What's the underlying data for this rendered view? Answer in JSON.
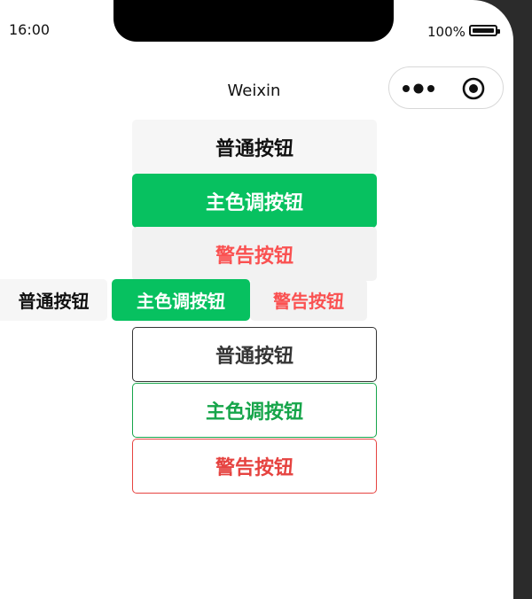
{
  "status_bar": {
    "time": "16:00",
    "battery": "100%"
  },
  "nav": {
    "title": "Weixin"
  },
  "buttons": {
    "block": {
      "default": "普通按钮",
      "primary": "主色调按钮",
      "warn": "警告按钮"
    },
    "mini": {
      "default": "普通按钮",
      "primary": "主色调按钮",
      "warn": "警告按钮"
    },
    "plain": {
      "default": "普通按钮",
      "primary": "主色调按钮",
      "warn": "警告按钮"
    }
  },
  "colors": {
    "primary": "#07c160",
    "warn": "#fa5151",
    "default_bg": "#f6f6f6"
  }
}
